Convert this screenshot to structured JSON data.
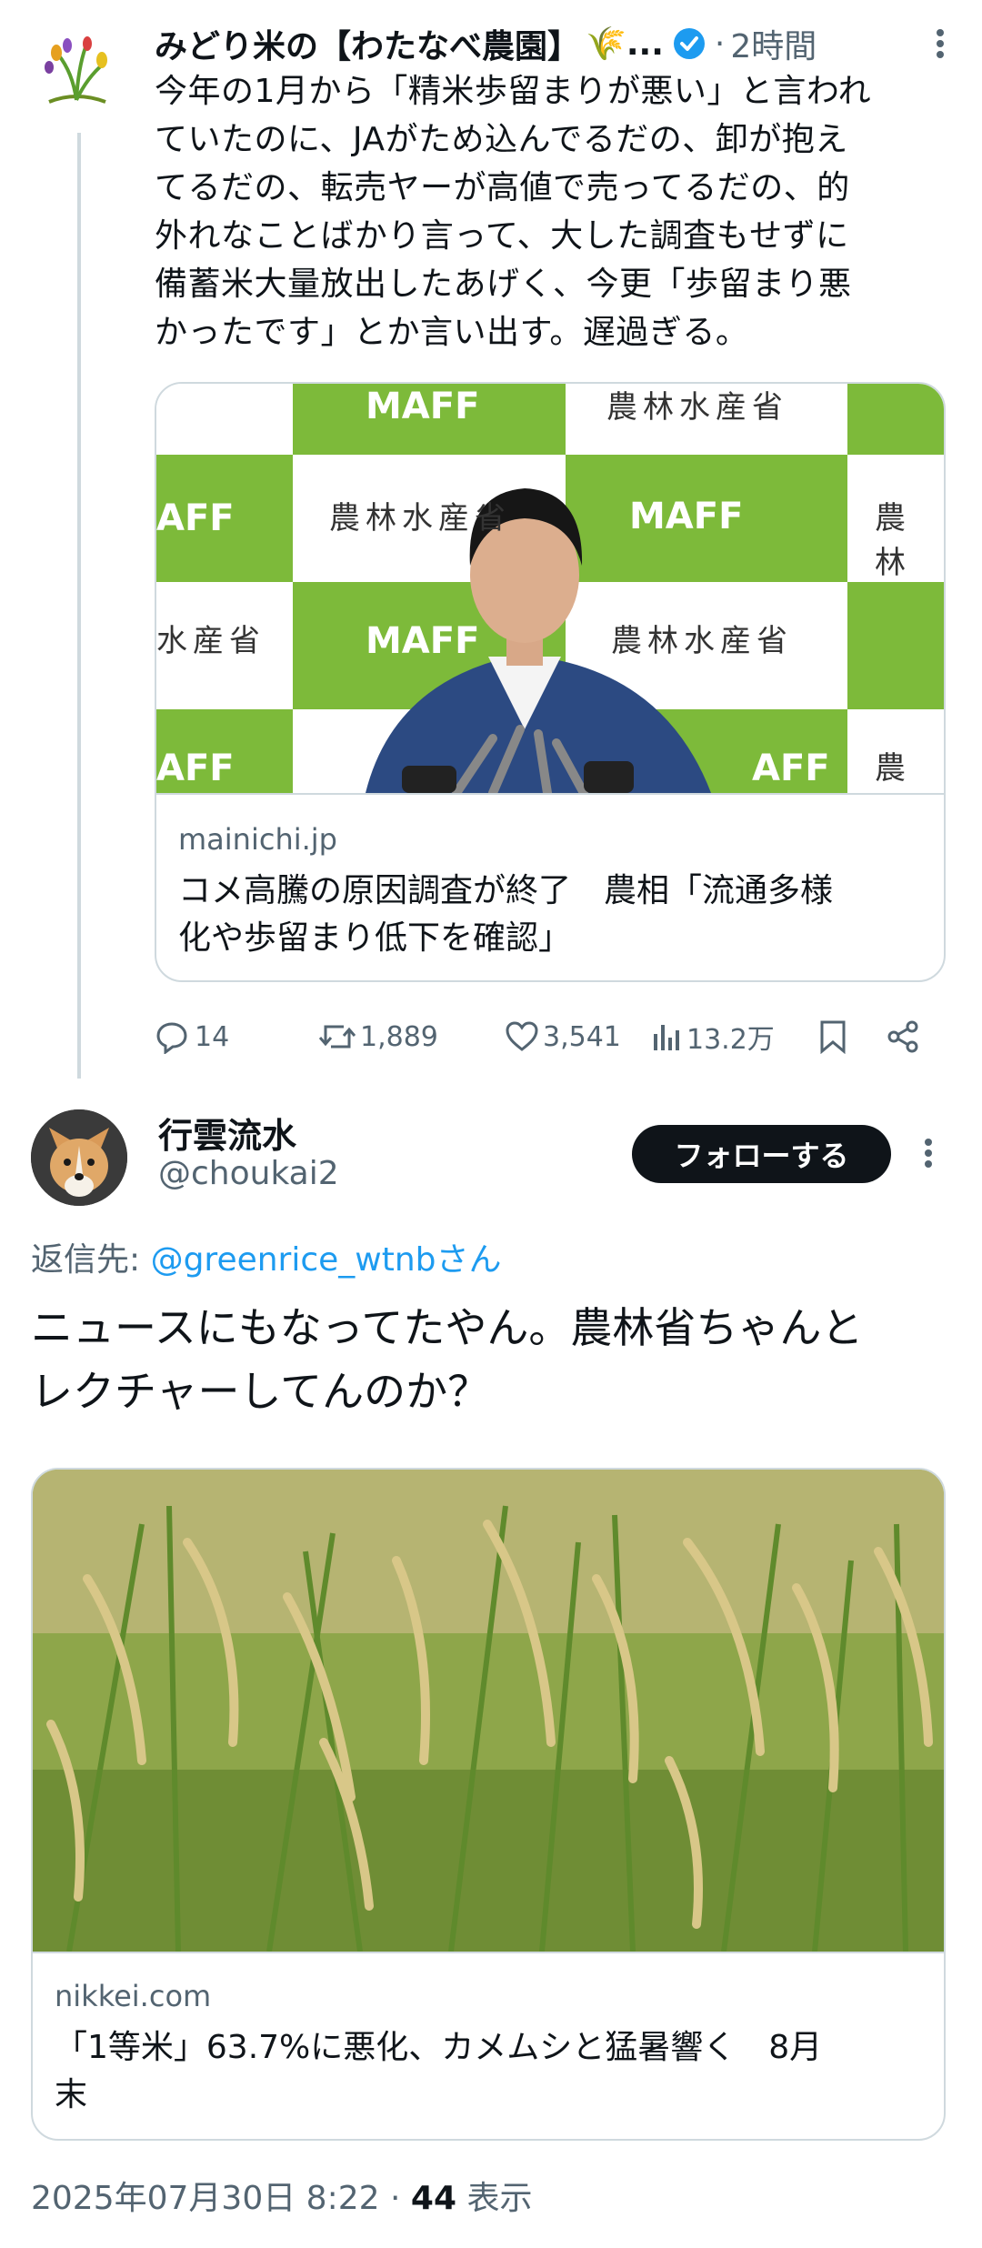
{
  "tweet1": {
    "author_name": "みどり米の【わたなべ農園】",
    "author_emoji": "🌾...",
    "time": "2時間",
    "text_lines": [
      "今年の1月から「精米歩留まりが悪い」と言われ",
      "ていたのに、JAがため込んでるだの、卸が抱え",
      "てるだの、転売ヤーが高値で売ってるだの、的",
      "外れなことばかり言って、大した調査もせずに",
      "備蓄米大量放出したあげく、今更「歩留まり悪",
      "かったです」とか言い出す。遅過ぎる。"
    ],
    "card": {
      "backdrop_texts": {
        "maff": "MAFF",
        "ministry": "農林水産省",
        "partial_left": "水産省",
        "partial_right": "農林",
        "partial_aff": "AFF"
      },
      "domain": "mainichi.jp",
      "title_lines": [
        "コメ高騰の原因調査が終了　農相「流通多様",
        "化や歩留まり低下を確認」"
      ]
    },
    "actions": {
      "replies": "14",
      "retweets": "1,889",
      "likes": "3,541",
      "views": "13.2万"
    }
  },
  "tweet2": {
    "author_name": "行雲流水",
    "handle": "@choukai2",
    "follow_label": "フォローする",
    "reply_prefix": "返信先: ",
    "reply_handle": "@greenrice_wtnbさん",
    "text_lines": [
      "ニュースにもなってたやん。農林省ちゃんと",
      "レクチャーしてんのか？"
    ],
    "card": {
      "domain": "nikkei.com",
      "title_lines": [
        "「1等米」63.7%に悪化、カメムシと猛暑響く　8月",
        "末"
      ]
    },
    "date": "2025年07月30日 8:22",
    "separator": "·",
    "views_count": "44",
    "views_label": "表示"
  },
  "colors": {
    "accent": "#1d9bf0",
    "text": "#0f1419",
    "muted": "#536471",
    "border": "#cfd9de",
    "maff_green": "#7dba3a"
  }
}
